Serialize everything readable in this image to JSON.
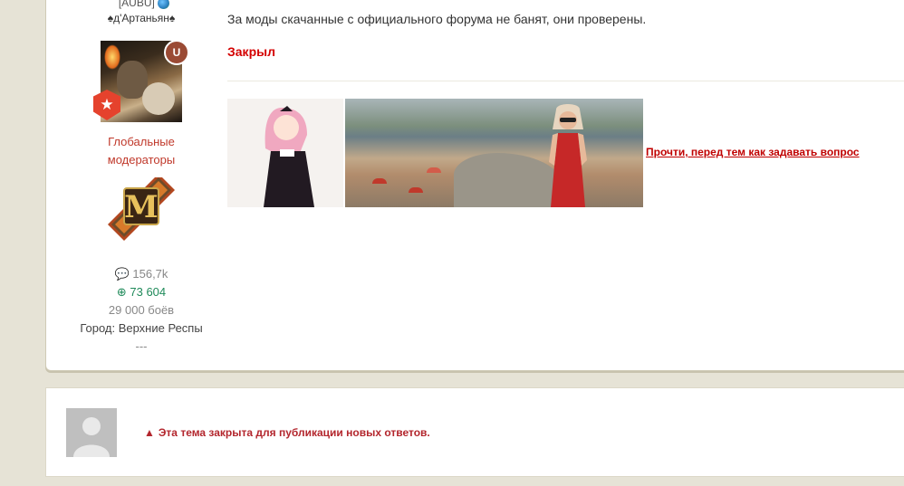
{
  "author": {
    "top_tag": "[AUBU]",
    "name": "♠д'Артаньян♠",
    "mod_badge": "U",
    "group_lines": [
      "Глобальные",
      "модераторы"
    ],
    "stats": {
      "posts": "156,7k",
      "reputation": "73 604",
      "battles": "29 000 боёв",
      "city": "Город: Верхние Респы",
      "extra": "---"
    }
  },
  "post": {
    "text": "За моды скачанные с официального форума не банят, они проверены.",
    "closed_label": "Закрыл",
    "read_link": "Прочти, перед тем как задавать вопрос"
  },
  "reply": {
    "locked_message": "Эта тема закрыта для публикации новых ответов."
  },
  "icons": {
    "comment": "comment-icon",
    "plus": "plus-circle-icon",
    "warning": "warning-icon"
  },
  "colors": {
    "accent_red": "#d40000",
    "group_red": "#c0392b",
    "rep_green": "#1f8a5a",
    "page_bg": "#e6e3d6"
  }
}
